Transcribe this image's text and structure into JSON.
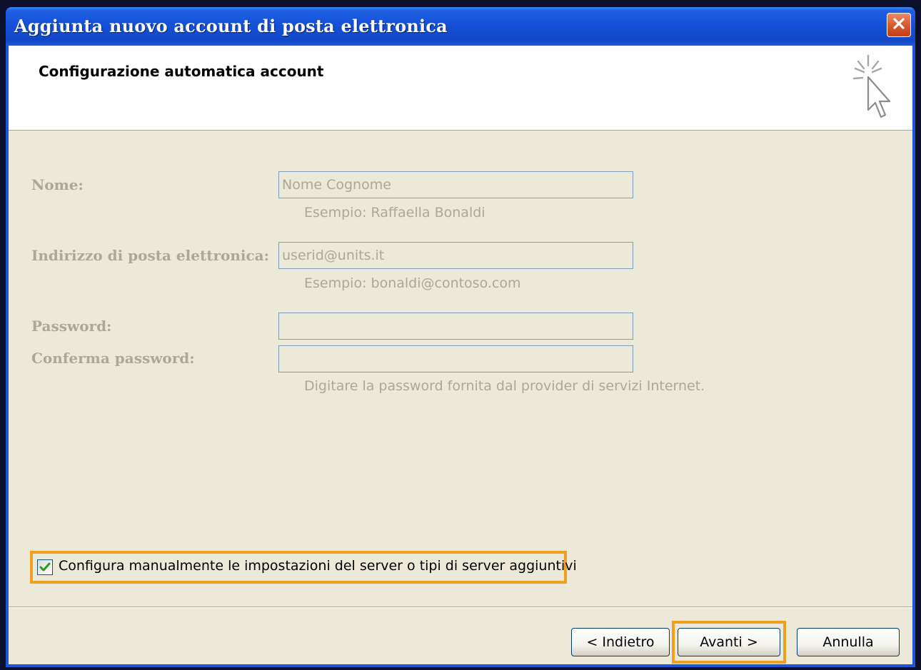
{
  "window": {
    "title": "Aggiunta nuovo account di posta elettronica"
  },
  "header": {
    "title": "Configurazione automatica account",
    "icon": "cursor-click-icon"
  },
  "form": {
    "name": {
      "label": "Nome:",
      "value": "Nome Cognome",
      "hint": "Esempio: Raffaella Bonaldi"
    },
    "email": {
      "label": "Indirizzo di posta elettronica:",
      "value": "userid@units.it",
      "hint": "Esempio: bonaldi@contoso.com"
    },
    "password": {
      "label": "Password:",
      "value": ""
    },
    "confirm_password": {
      "label": "Conferma password:",
      "value": "",
      "hint": "Digitare la password fornita dal provider di servizi Internet."
    },
    "disabled": true
  },
  "manual_config": {
    "label": "Configura manualmente le impostazioni del server o tipi di server aggiuntivi",
    "checked": true,
    "highlighted": true
  },
  "buttons": {
    "back": "< Indietro",
    "next": "Avanti >",
    "cancel": "Annulla",
    "next_highlighted": true
  },
  "colors": {
    "titlebar": "#1550d8",
    "dialog_bg": "#ece9d8",
    "highlight": "#f0a020",
    "disabled_text": "#aca899",
    "check_green": "#21a121"
  }
}
